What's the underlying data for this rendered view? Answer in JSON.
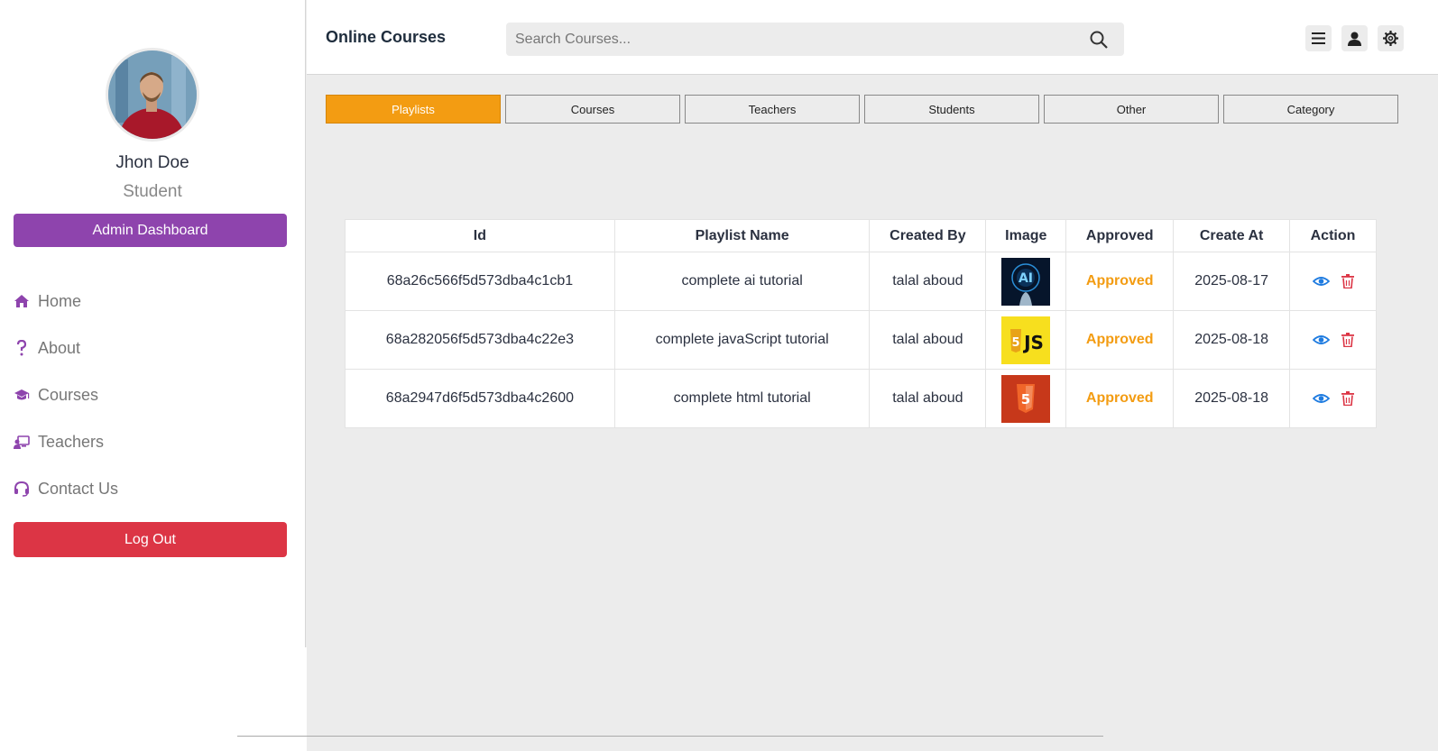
{
  "sidebar": {
    "profile": {
      "name": "Jhon Doe",
      "role": "Student"
    },
    "admin_button": "Admin Dashboard",
    "nav": [
      {
        "label": "Home",
        "icon": "home-icon"
      },
      {
        "label": "About",
        "icon": "question-icon"
      },
      {
        "label": "Courses",
        "icon": "graduation-cap-icon"
      },
      {
        "label": "Teachers",
        "icon": "teacher-icon"
      },
      {
        "label": "Contact Us",
        "icon": "headset-icon"
      }
    ],
    "logout_button": "Log Out"
  },
  "header": {
    "brand": "Online Courses",
    "search": {
      "placeholder": "Search Courses...",
      "value": ""
    },
    "icons": [
      "menu-icon",
      "user-icon",
      "settings-icon"
    ]
  },
  "tabs": [
    {
      "label": "Playlists",
      "active": true
    },
    {
      "label": "Courses",
      "active": false
    },
    {
      "label": "Teachers",
      "active": false
    },
    {
      "label": "Students",
      "active": false
    },
    {
      "label": "Other",
      "active": false
    },
    {
      "label": "Category",
      "active": false
    }
  ],
  "table": {
    "columns": [
      "Id",
      "Playlist Name",
      "Created By",
      "Image",
      "Approved",
      "Create At",
      "Action"
    ],
    "rows": [
      {
        "id": "68a26c566f5d573dba4c1cb1",
        "name": "complete ai tutorial",
        "created_by": "talal aboud",
        "image": "ai-thumbnail",
        "approved": "Approved",
        "created_at": "2025-08-17"
      },
      {
        "id": "68a282056f5d573dba4c22e3",
        "name": "complete javaScript tutorial",
        "created_by": "talal aboud",
        "image": "js-thumbnail",
        "approved": "Approved",
        "created_at": "2025-08-18"
      },
      {
        "id": "68a2947d6f5d573dba4c2600",
        "name": "complete html tutorial",
        "created_by": "talal aboud",
        "image": "html-thumbnail",
        "approved": "Approved",
        "created_at": "2025-08-18"
      }
    ]
  },
  "colors": {
    "accent_purple": "#8e44ad",
    "accent_orange": "#f39c12",
    "danger": "#dc3545",
    "view_blue": "#1e7be0"
  }
}
